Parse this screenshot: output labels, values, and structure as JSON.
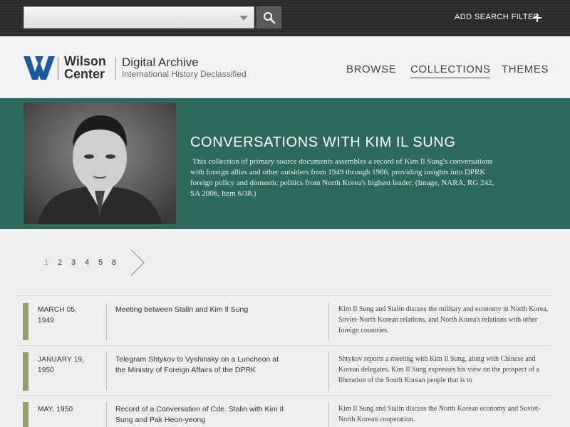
{
  "topbar": {
    "search_value": "",
    "add_filter_label": "ADD SEARCH FILTER"
  },
  "header": {
    "logo_text_line1": "Wilson",
    "logo_text_line2": "Center",
    "title": "Digital Archive",
    "subtitle": "International History Declassified",
    "nav": [
      "BROWSE",
      "COLLECTIONS",
      "THEMES"
    ],
    "active_nav": "COLLECTIONS"
  },
  "hero": {
    "title": "CONVERSATIONS WITH KIM IL SUNG",
    "description": "This collection of primary source documents assembles a record of Kim Il Sung's conversations with foreign allies and other outsiders from 1949 through 1986, providing insights into DPRK foreign policy and domestic politics from North Korea's highest leader. (Image, NARA, RG 242, SA 2006, Item 6/38.)"
  },
  "pagination": {
    "pages": [
      "1",
      "2",
      "3",
      "4",
      "5",
      "8"
    ],
    "current": "1"
  },
  "records": [
    {
      "date": "MARCH 05, 1949",
      "title": "Meeting between Stalin and Kim Il Sung",
      "description": "Kim Il Sung and Stalin discuss the military and economy in North Korea, Soviet-North Korean relations, and North Korea's relations with other foreign countries."
    },
    {
      "date": "JANUARY 19, 1950",
      "title": "Telegram Shtykov to Vyshinsky on a Luncheon at the Ministry of Foreign Affairs of the DPRK",
      "description": "Shtykov reports a meeting with Kim Il Sung, along with Chinese and Korean delegates. Kim Il Sung expresses his view on the prospect of a liberation of the South Korean people that is to"
    },
    {
      "date": "MAY, 1950",
      "title": "Record of a Conversation of Cde. Stalin with Kim Il Sung and Pak Heon-yeong",
      "description": "Kim Il Sung and Stalin discuss the North Korean economy and Soviet-North Korean cooperation."
    }
  ],
  "colors": {
    "hero_bg": "#2e6a5c",
    "accent_bar": "#8fa06a",
    "logo_blue": "#1a5a9e"
  }
}
